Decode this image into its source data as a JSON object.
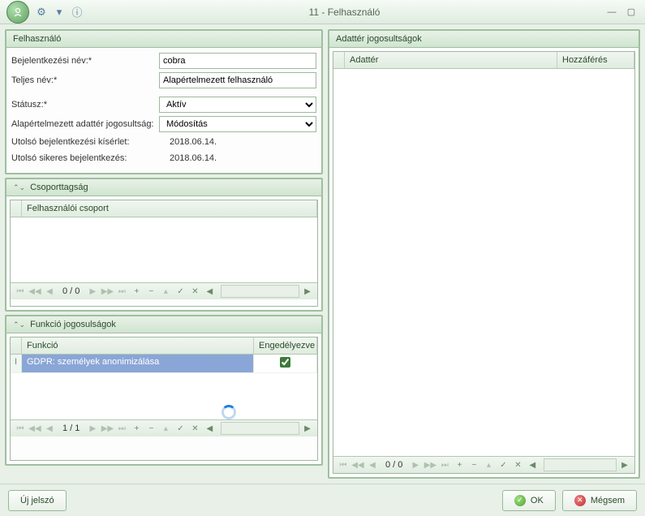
{
  "window": {
    "title": "11 - Felhasználó"
  },
  "user_panel": {
    "title": "Felhasználó",
    "login_name_label": "Bejelentkezési név:*",
    "login_name_value": "cobra",
    "full_name_label": "Teljes név:*",
    "full_name_value": "Alapértelmezett felhasználó",
    "status_label": "Státusz:*",
    "status_value": "Aktív",
    "default_perm_label": "Alapértelmezett adattér jogosultság:",
    "default_perm_value": "Módosítás",
    "last_attempt_label": "Utolsó bejelentkezési kísérlet:",
    "last_attempt_value": "2018.06.14.",
    "last_success_label": "Utolsó sikeres bejelentkezés:",
    "last_success_value": "2018.06.14."
  },
  "groups_panel": {
    "title": "Csoporttagság",
    "col_group": "Felhasználói csoport",
    "position": "0 / 0"
  },
  "functions_panel": {
    "title": "Funkció jogosulságok",
    "col_function": "Funkció",
    "col_enabled": "Engedélyezve",
    "rows": [
      {
        "function": "GDPR: személyek anonimizálása",
        "enabled": true
      }
    ],
    "position": "1 / 1"
  },
  "dataspace_panel": {
    "title": "Adattér jogosultságok",
    "col_dataspace": "Adattér",
    "col_access": "Hozzáférés",
    "position": "0 / 0"
  },
  "footer": {
    "new_password": "Új jelszó",
    "ok": "OK",
    "cancel": "Mégsem"
  }
}
